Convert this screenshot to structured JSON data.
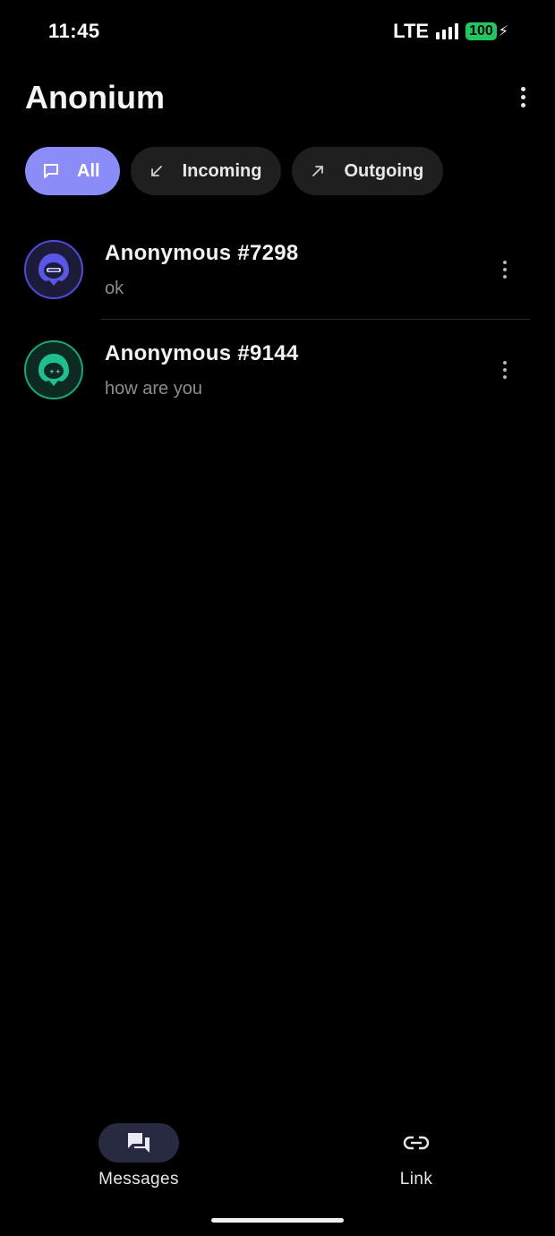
{
  "status_bar": {
    "time": "11:45",
    "network": "LTE",
    "battery": "100"
  },
  "header": {
    "title": "Anonium"
  },
  "filters": [
    {
      "label": "All",
      "icon": "chat-bubble-icon",
      "active": true
    },
    {
      "label": "Incoming",
      "icon": "arrow-down-left-icon",
      "active": false
    },
    {
      "label": "Outgoing",
      "icon": "arrow-up-right-icon",
      "active": false
    }
  ],
  "conversations": [
    {
      "name": "Anonymous #7298",
      "preview": "ok",
      "avatar_color": "#4f4bd6"
    },
    {
      "name": "Anonymous #9144",
      "preview": "how are you",
      "avatar_color": "#19a57a"
    }
  ],
  "bottom_nav": {
    "messages_label": "Messages",
    "link_label": "Link"
  },
  "colors": {
    "accent": "#8b8cf8",
    "background": "#000000",
    "battery": "#22c55e"
  }
}
